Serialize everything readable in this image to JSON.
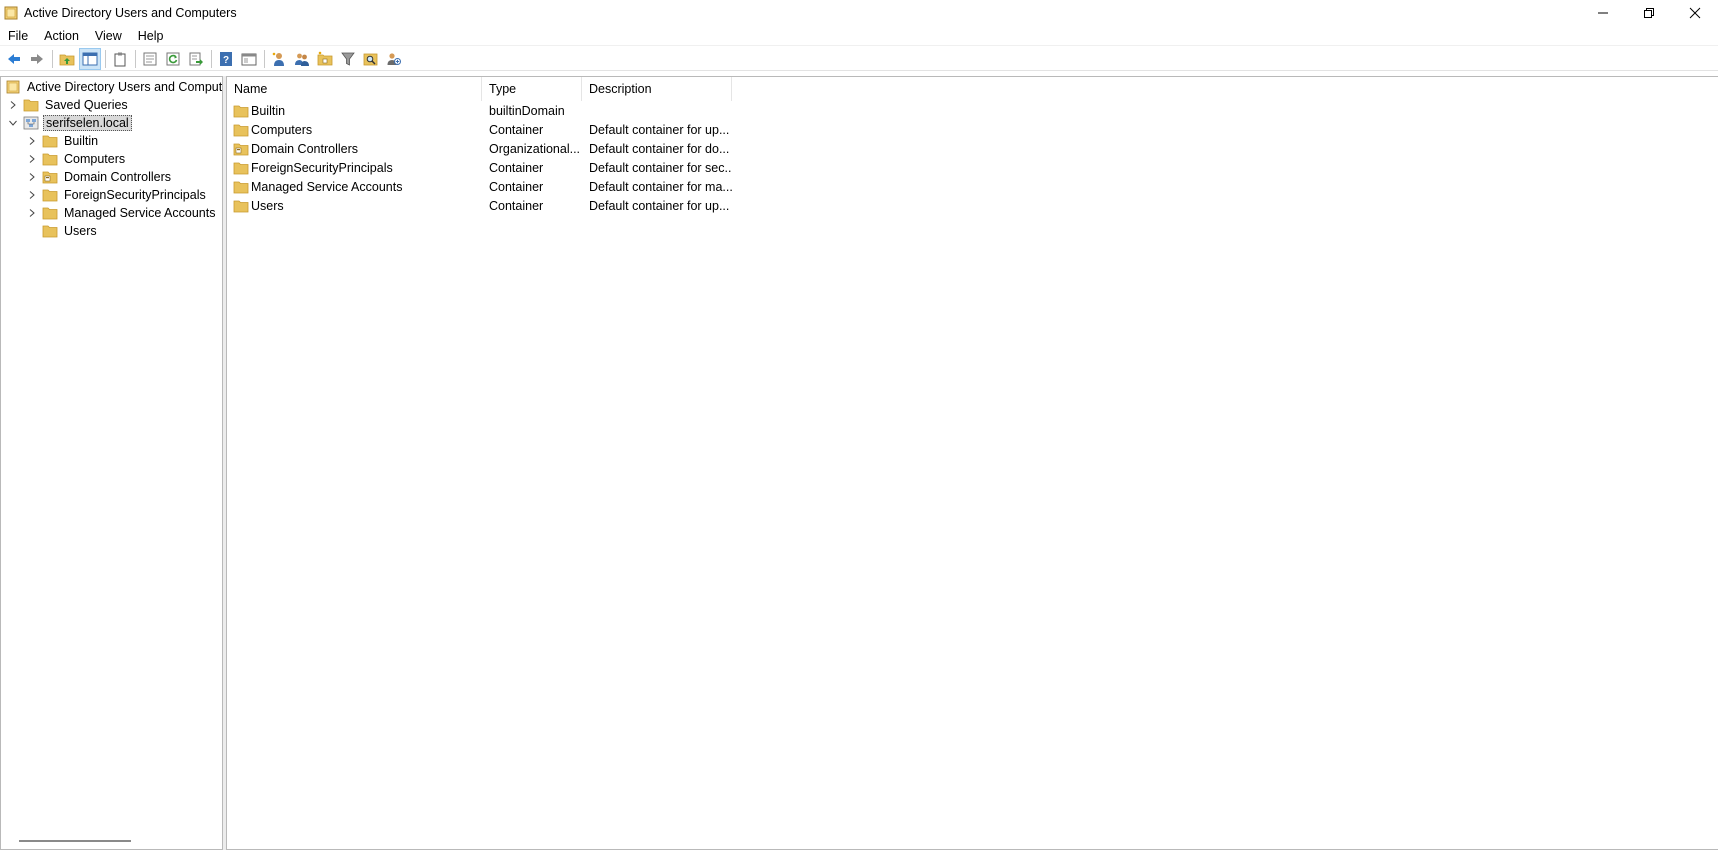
{
  "window": {
    "title": "Active Directory Users and Computers"
  },
  "menu": [
    "File",
    "Action",
    "View",
    "Help"
  ],
  "toolbar": {
    "buttons": [
      "back-icon",
      "forward-icon",
      "up-folder-icon",
      "show-tree-icon",
      "clipboard-icon",
      "properties-icon",
      "refresh-icon",
      "export-list-icon",
      "help-icon",
      "mmc-view-icon",
      "new-user-icon",
      "new-group-icon",
      "new-ou-icon",
      "filter-icon",
      "find-icon",
      "add-to-group-icon"
    ]
  },
  "tree": {
    "root": "Active Directory Users and Computers",
    "saved_queries": "Saved Queries",
    "domain": "serifselen.local",
    "children": [
      {
        "label": "Builtin",
        "icon": "folder-icon",
        "expandable": true
      },
      {
        "label": "Computers",
        "icon": "folder-icon",
        "expandable": true
      },
      {
        "label": "Domain Controllers",
        "icon": "ou-folder-icon",
        "expandable": true
      },
      {
        "label": "ForeignSecurityPrincipals",
        "icon": "folder-icon",
        "expandable": true
      },
      {
        "label": "Managed Service Accounts",
        "icon": "folder-icon",
        "expandable": true
      },
      {
        "label": "Users",
        "icon": "folder-icon",
        "expandable": false
      }
    ]
  },
  "list": {
    "columns": {
      "name": "Name",
      "type": "Type",
      "description": "Description"
    },
    "rows": [
      {
        "name": "Builtin",
        "type": "builtinDomain",
        "description": "",
        "icon": "folder-icon"
      },
      {
        "name": "Computers",
        "type": "Container",
        "description": "Default container for up...",
        "icon": "folder-icon"
      },
      {
        "name": "Domain Controllers",
        "type": "Organizational...",
        "description": "Default container for do...",
        "icon": "ou-folder-icon"
      },
      {
        "name": "ForeignSecurityPrincipals",
        "type": "Container",
        "description": "Default container for sec...",
        "icon": "folder-icon"
      },
      {
        "name": "Managed Service Accounts",
        "type": "Container",
        "description": "Default container for ma...",
        "icon": "folder-icon"
      },
      {
        "name": "Users",
        "type": "Container",
        "description": "Default container for up...",
        "icon": "folder-icon"
      }
    ]
  },
  "colors": {
    "folder": "#e8c25c",
    "folder_dark": "#c99a2e",
    "accent_blue": "#2b7cd3",
    "selected_bg": "#d9d9d9"
  }
}
